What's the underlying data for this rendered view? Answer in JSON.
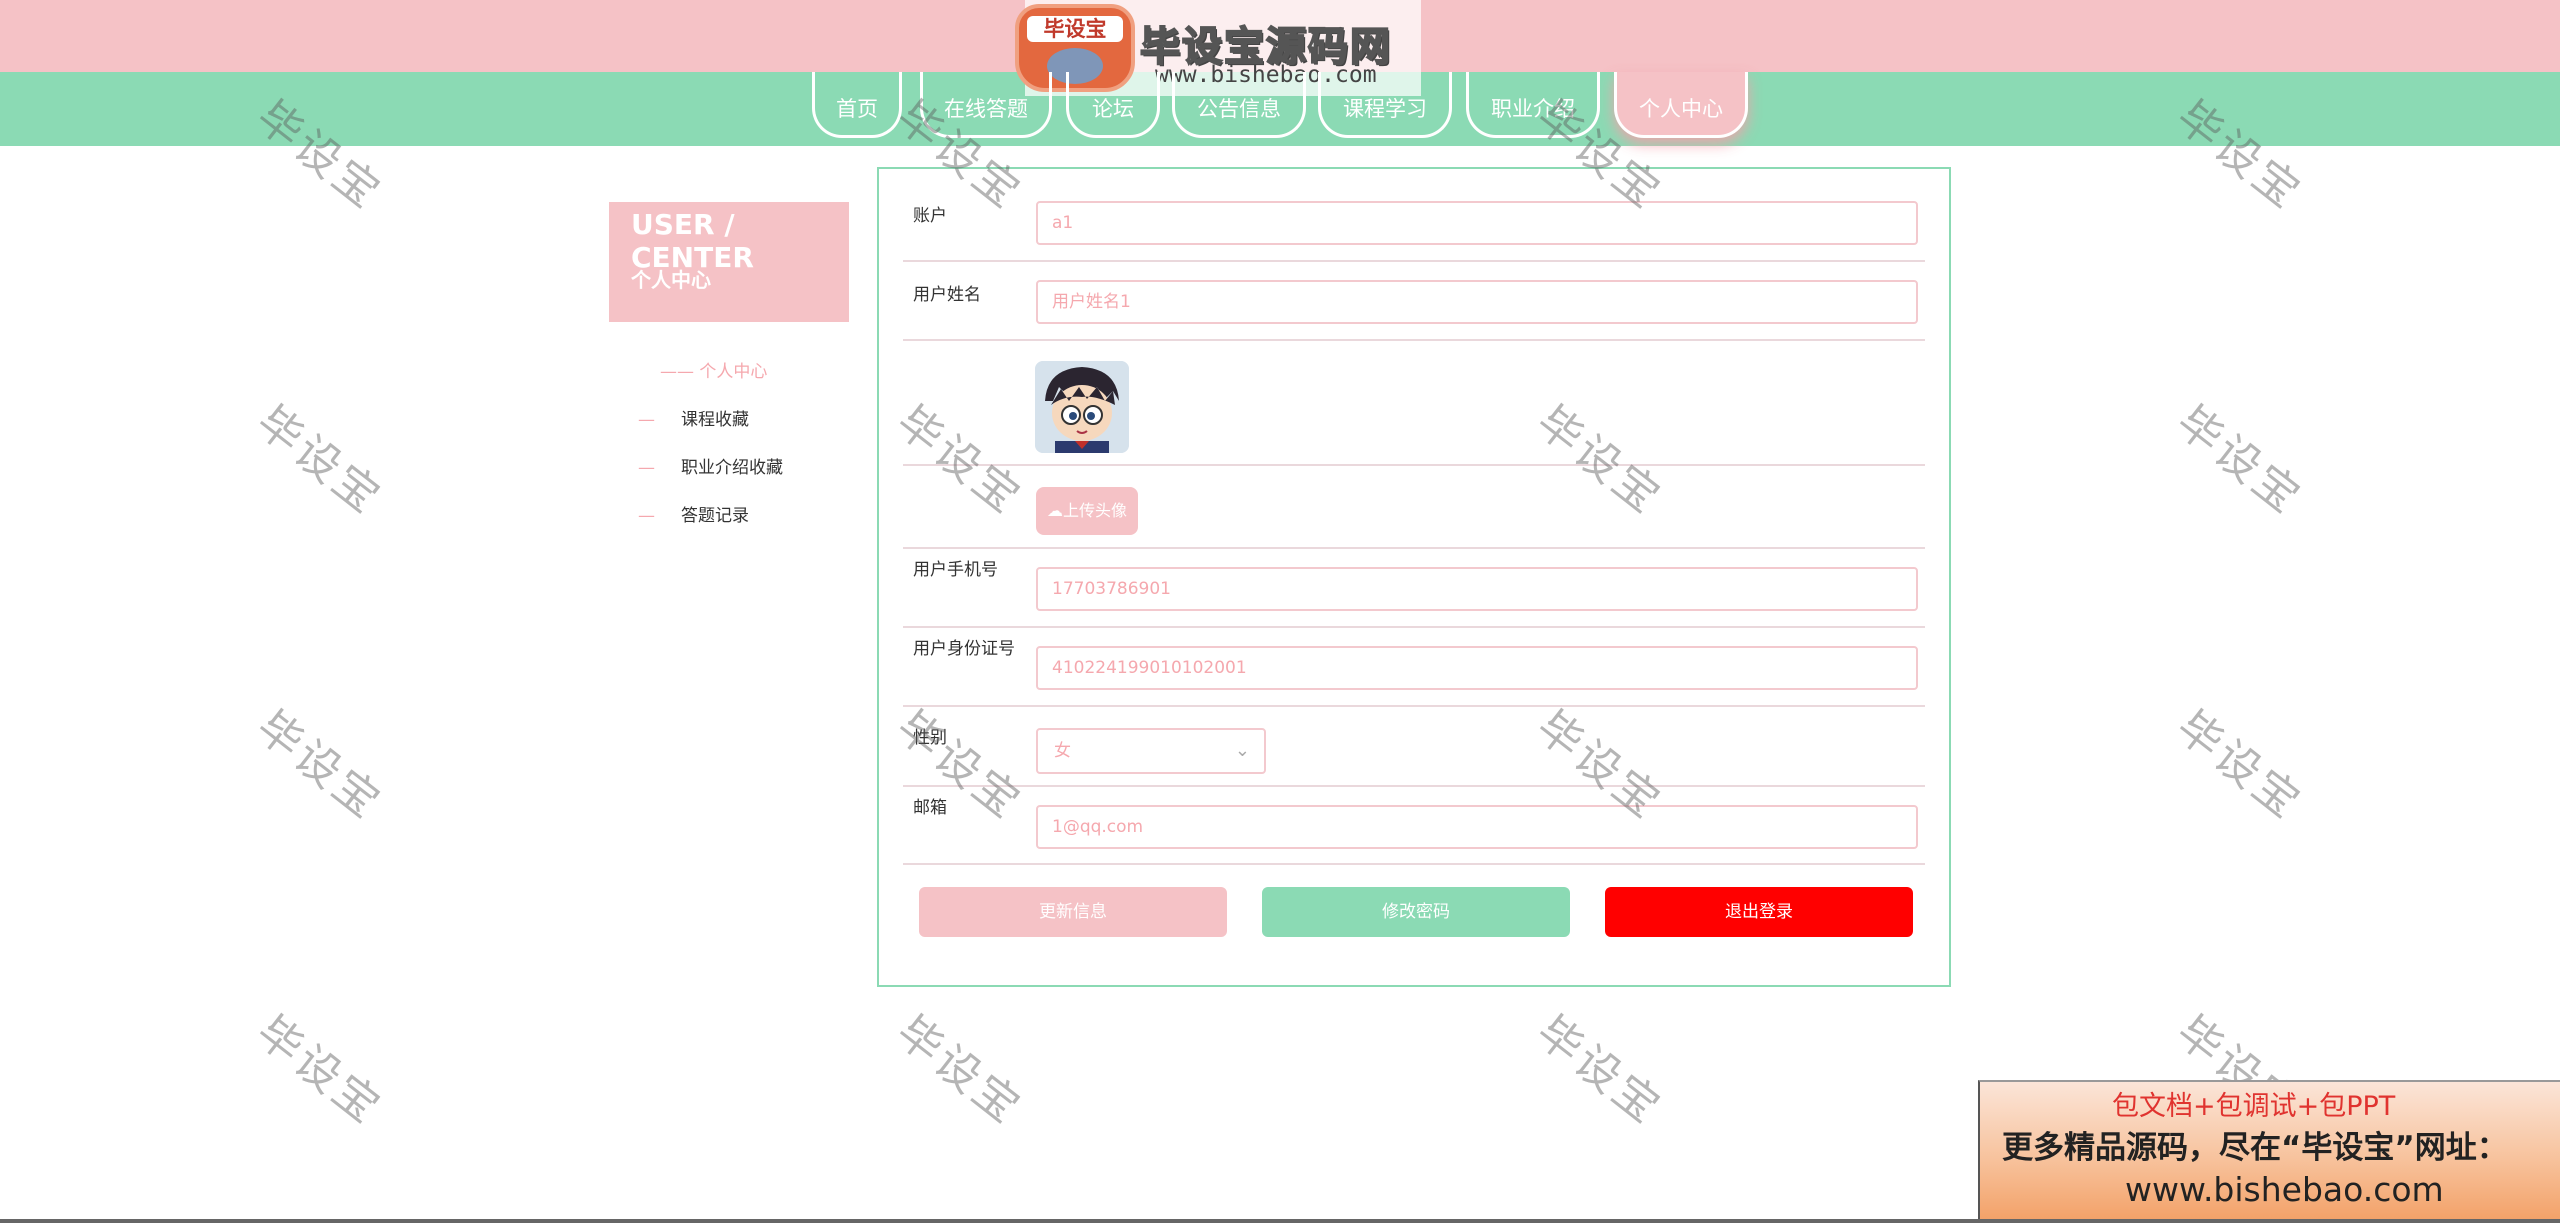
{
  "site": {
    "logo_badge": "毕设宝",
    "logo_title": "毕设宝源码网",
    "logo_url": "www.bishebao.com"
  },
  "nav": {
    "items": [
      "首页",
      "在线答题",
      "论坛",
      "公告信息",
      "课程学习",
      "职业介绍",
      "个人中心"
    ],
    "active": "个人中心"
  },
  "sidebar": {
    "heading_en": "USER / CENTER",
    "heading_cn": "个人中心",
    "active_item": "—— 个人中心",
    "links": [
      {
        "dash": "—",
        "label": "课程收藏"
      },
      {
        "dash": "—",
        "label": "职业介绍收藏"
      },
      {
        "dash": "—",
        "label": "答题记录"
      }
    ]
  },
  "form": {
    "account": {
      "label": "账户",
      "value": "a1"
    },
    "name": {
      "label": "用户姓名",
      "value": "用户姓名1"
    },
    "upload_label": "上传头像",
    "phone": {
      "label": "用户手机号",
      "value": "17703786901"
    },
    "id_card": {
      "label": "用户身份证号",
      "value": "410224199010102001"
    },
    "gender": {
      "label": "性别",
      "value": "女"
    },
    "email": {
      "label": "邮箱",
      "value": "1@qq.com"
    }
  },
  "buttons": {
    "update": "更新信息",
    "change_password": "修改密码",
    "logout": "退出登录"
  },
  "watermark": "毕设宝",
  "ad": {
    "line1": "包文档+包调试+包PPT",
    "line2": "更多精品源码，尽在“毕设宝”网址：",
    "line3": "www.bishebao.com"
  },
  "colors": {
    "pink": "#f5c2c6",
    "green": "#8bdab4",
    "logout_red": "#ff0000"
  }
}
